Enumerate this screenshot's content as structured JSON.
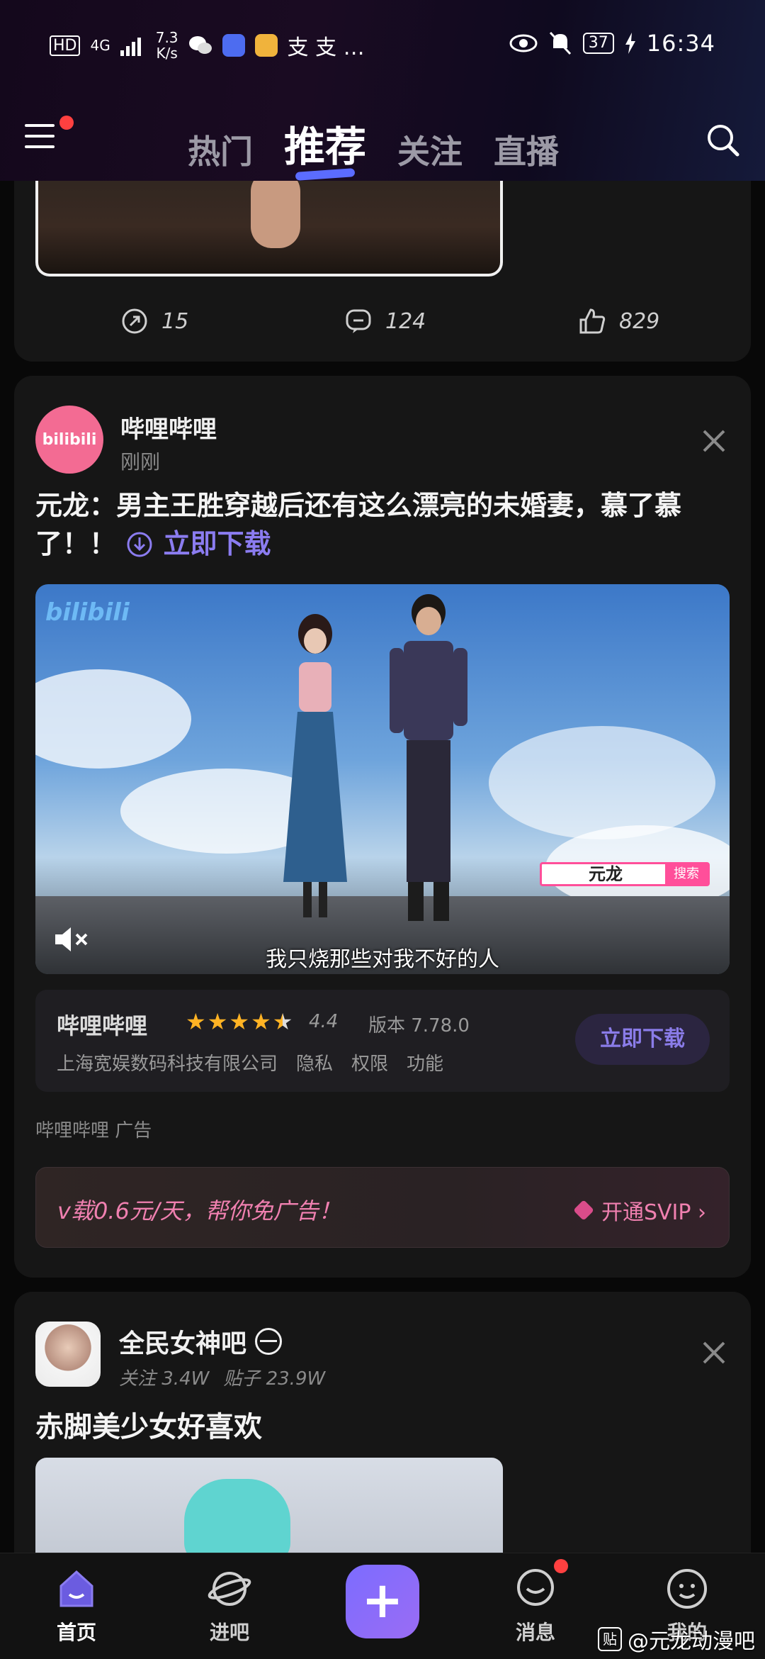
{
  "status_bar": {
    "hd": "HD",
    "net": "4G",
    "speed_value": "7.3",
    "speed_unit": "K/s",
    "app_glyphs": "支 支 …",
    "battery": "37",
    "time": "16:34"
  },
  "header": {
    "tabs": [
      "热门",
      "推荐",
      "关注",
      "直播"
    ],
    "active_tab": "推荐"
  },
  "post_prev": {
    "shares": "15",
    "comments": "124",
    "likes": "829"
  },
  "ad_post": {
    "avatar_text": "bilibili",
    "author": "哔哩哔哩",
    "time": "刚刚",
    "title": "元龙：男主王胜穿越后还有这么漂亮的未婚妻，慕了慕了！！",
    "download_link": "立即下载",
    "video": {
      "watermark": "bilibili",
      "search_chip_text": "元龙",
      "search_chip_btn": "搜索",
      "subtitle": "我只烧那些对我不好的人"
    },
    "app": {
      "name": "哔哩哔哩",
      "rating": "4.4",
      "stars_filled": 4.5,
      "version": "版本 7.78.0",
      "developer": "上海宽娱数码科技有限公司",
      "links": [
        "隐私",
        "权限",
        "功能"
      ],
      "download_button": "立即下载"
    },
    "ad_label": "哔哩哔哩  广告",
    "svip": {
      "text": "v载0.6元/天，帮你免广告！",
      "cta": "开通SVIP ›"
    }
  },
  "forum_post": {
    "forum": "全民女神吧",
    "follow": "关注 3.4W",
    "posts": "贴子 23.9W",
    "title": "赤脚美少女好喜欢"
  },
  "bottom_nav": {
    "items": [
      "首页",
      "进吧",
      "消息",
      "我的"
    ],
    "active": "首页"
  },
  "watermark": {
    "badge": "贴",
    "text": "@元龙动漫吧"
  },
  "colors": {
    "accent": "#7c6cff",
    "star": "#ffb324",
    "badge": "#ff4040",
    "svip": "#f080b0"
  }
}
